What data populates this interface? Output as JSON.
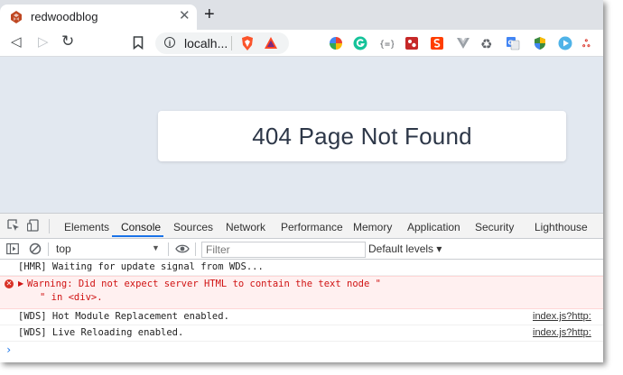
{
  "browser": {
    "tab_title": "redwoodblog",
    "close_glyph": "✕",
    "newtab_glyph": "+",
    "back_glyph": "◁",
    "forward_glyph": "▷",
    "reload_glyph": "↻",
    "bookmark_glyph": "⎕",
    "url": "localh...",
    "info_glyph": "i"
  },
  "page": {
    "heading": "404 Page Not Found"
  },
  "devtools": {
    "tabs": [
      "Elements",
      "Console",
      "Sources",
      "Network",
      "Performance",
      "Memory",
      "Application",
      "Security",
      "Lighthouse"
    ],
    "active_tab": "Console",
    "context": "top",
    "filter_placeholder": "Filter",
    "levels_label": "Default levels ▾",
    "messages": [
      {
        "text": "[HMR] Waiting for update signal from WDS...",
        "source": ""
      },
      {
        "type": "warning",
        "line1": "Warning: Did not expect server HTML to contain the text node \"",
        "line2": "\" in <div>.",
        "source": ""
      },
      {
        "text": "[WDS] Hot Module Replacement enabled.",
        "source": "index.js?http:"
      },
      {
        "text": "[WDS] Live Reloading enabled.",
        "source": "index.js?http:"
      }
    ],
    "prompt_glyph": "›"
  },
  "colors": {
    "page_bg": "#e2e8f0",
    "accent": "#1a73e8",
    "error": "#d01313"
  }
}
